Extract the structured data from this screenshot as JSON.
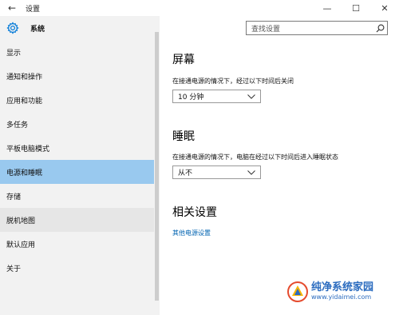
{
  "window": {
    "title": "设置",
    "back_glyph": "←",
    "minimize_glyph": "—",
    "maximize_glyph": "☐",
    "close_glyph": "✕"
  },
  "sidebar": {
    "header_title": "系统",
    "header_icon": "gear-icon",
    "items": [
      {
        "label": "显示"
      },
      {
        "label": "通知和操作"
      },
      {
        "label": "应用和功能"
      },
      {
        "label": "多任务"
      },
      {
        "label": "平板电脑模式"
      },
      {
        "label": "电源和睡眠",
        "active": true
      },
      {
        "label": "存储"
      },
      {
        "label": "脱机地图"
      },
      {
        "label": "默认应用"
      },
      {
        "label": "关于"
      }
    ]
  },
  "search": {
    "placeholder": "查找设置",
    "icon": "search-icon"
  },
  "main": {
    "screen": {
      "title": "屏幕",
      "description": "在接通电源的情况下，经过以下时间后关闭",
      "selected": "10 分钟"
    },
    "sleep": {
      "title": "睡眠",
      "description": "在接通电源的情况下，电脑在经过以下时间后进入睡眠状态",
      "selected": "从不"
    },
    "related": {
      "title": "相关设置",
      "link": "其他电源设置"
    }
  },
  "watermark": {
    "name": "纯净系统家园",
    "url": "www.yidaimei.com"
  },
  "colors": {
    "sidebar_bg": "#f2f2f2",
    "active_item": "#99c9ef",
    "link": "#0063b1",
    "accent": "#0078d7"
  }
}
